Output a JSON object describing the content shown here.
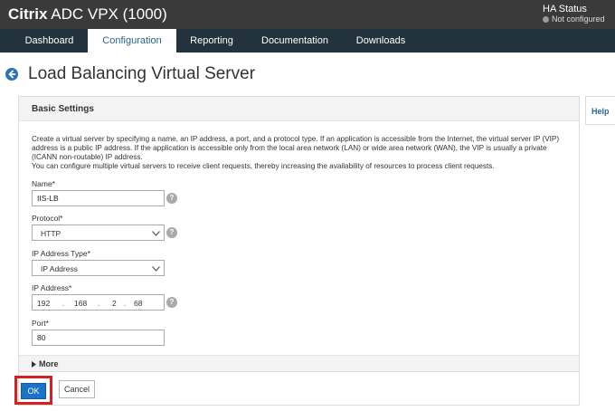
{
  "header": {
    "brand_bold": "Citrix",
    "brand_rest": "ADC VPX (1000)",
    "ha_title": "HA Status",
    "ha_status": "Not configured"
  },
  "nav": {
    "tabs": [
      {
        "label": "Dashboard"
      },
      {
        "label": "Configuration"
      },
      {
        "label": "Reporting"
      },
      {
        "label": "Documentation"
      },
      {
        "label": "Downloads"
      }
    ],
    "active": "Configuration"
  },
  "page": {
    "title": "Load Balancing Virtual Server",
    "help": "Help"
  },
  "section": {
    "title": "Basic Settings",
    "description_1": "Create a virtual server by specifying a name, an IP address, a port, and a protocol type. If an application is accessible from the Internet, the virtual server IP (VIP) address is a public IP address. If the application is accessible only from the local area network (LAN) or wide area network (WAN), the VIP is usually a private (ICANN non-routable) IP address.",
    "description_2": "You can configure multiple virtual servers to receive client requests, thereby increasing the availability of resources to process client requests."
  },
  "form": {
    "name_label": "Name*",
    "name_value": "IIS-LB",
    "protocol_label": "Protocol*",
    "protocol_value": "HTTP",
    "ip_type_label": "IP Address Type*",
    "ip_type_value": "IP Address",
    "ip_label": "IP Address*",
    "ip_octets": [
      "192",
      "168",
      "2",
      "68"
    ],
    "ip_sep": ".",
    "port_label": "Port*",
    "port_value": "80",
    "help_glyph": "?"
  },
  "more": {
    "label": "More"
  },
  "buttons": {
    "ok": "OK",
    "cancel": "Cancel"
  },
  "colors": {
    "accent": "#1a73c8",
    "highlight": "#d81e1e",
    "nav_bg": "#23333e",
    "header_bg": "#3a3a3a"
  }
}
